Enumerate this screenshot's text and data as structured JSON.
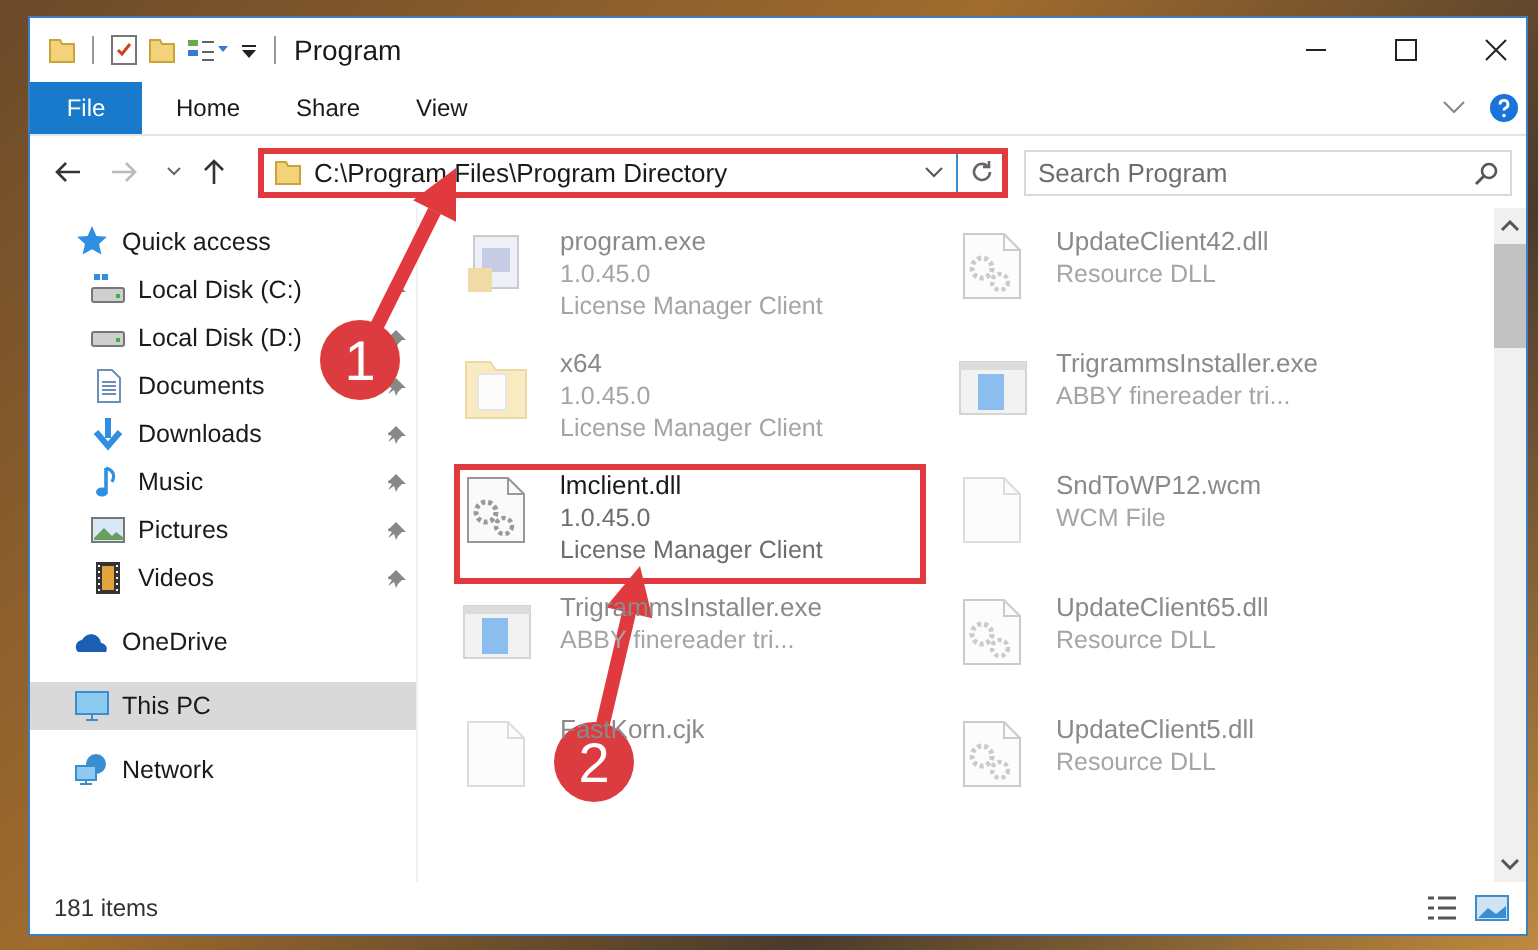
{
  "window": {
    "title": "Program"
  },
  "ribbon_tabs": [
    {
      "label": "File",
      "kind": "file",
      "selected": false
    },
    {
      "label": "Home",
      "kind": "tab",
      "selected": false
    },
    {
      "label": "Share",
      "kind": "tab",
      "selected": false
    },
    {
      "label": "View",
      "kind": "tab",
      "selected": false
    }
  ],
  "address_bar": {
    "path": "C:\\Program Files\\Program Directory",
    "highlighted": true
  },
  "search": {
    "placeholder": "Search Program"
  },
  "navigation": [
    {
      "label": "Quick access",
      "kind": "star",
      "selected": false,
      "children": [
        {
          "label": "Local Disk (C:)",
          "kind": "disk-c",
          "pinned": true,
          "selected": false
        },
        {
          "label": "Local Disk (D:)",
          "kind": "disk",
          "pinned": true,
          "selected": false
        },
        {
          "label": "Documents",
          "kind": "documents",
          "pinned": true,
          "selected": false
        },
        {
          "label": "Downloads",
          "kind": "downloads",
          "pinned": true,
          "selected": false
        },
        {
          "label": "Music",
          "kind": "music",
          "pinned": true,
          "selected": false
        },
        {
          "label": "Pictures",
          "kind": "pictures",
          "pinned": true,
          "selected": false
        },
        {
          "label": "Videos",
          "kind": "videos",
          "pinned": true,
          "selected": false
        }
      ]
    },
    {
      "label": "OneDrive",
      "kind": "cloud",
      "selected": false
    },
    {
      "label": "This PC",
      "kind": "pc",
      "selected": true
    },
    {
      "label": "Network",
      "kind": "network",
      "selected": false
    }
  ],
  "files": [
    {
      "name": "program.exe",
      "lines": [
        "1.0.45.0",
        "License Manager Client"
      ],
      "kind": "program",
      "highlighted": false
    },
    {
      "name": "UpdateClient42.dll",
      "lines": [
        "Resource DLL"
      ],
      "kind": "gears",
      "highlighted": false
    },
    {
      "name": "x64",
      "lines": [
        "1.0.45.0",
        "License Manager Client"
      ],
      "kind": "folder",
      "highlighted": false
    },
    {
      "name": "TrigrammsInstaller.exe",
      "lines": [
        "ABBY finereader tri..."
      ],
      "kind": "installer",
      "highlighted": false
    },
    {
      "name": "lmclient.dll",
      "lines": [
        "1.0.45.0",
        "License Manager Client"
      ],
      "kind": "gears",
      "highlighted": true
    },
    {
      "name": "SndToWP12.wcm",
      "lines": [
        "WCM File"
      ],
      "kind": "blank",
      "highlighted": false
    },
    {
      "name": "TrigrammsInstaller.exe",
      "lines": [
        "ABBY finereader tri..."
      ],
      "kind": "installer",
      "highlighted": false
    },
    {
      "name": "UpdateClient65.dll",
      "lines": [
        "Resource DLL"
      ],
      "kind": "gears",
      "highlighted": false
    },
    {
      "name": "FastKorn.cjk",
      "kind": "blank",
      "highlighted": false
    },
    {
      "name": "UpdateClient5.dll",
      "lines": [
        "Resource DLL"
      ],
      "kind": "gears",
      "highlighted": false
    }
  ],
  "callouts": [
    {
      "number": "1"
    },
    {
      "number": "2"
    }
  ],
  "status_bar": {
    "item_count": "181 items"
  }
}
